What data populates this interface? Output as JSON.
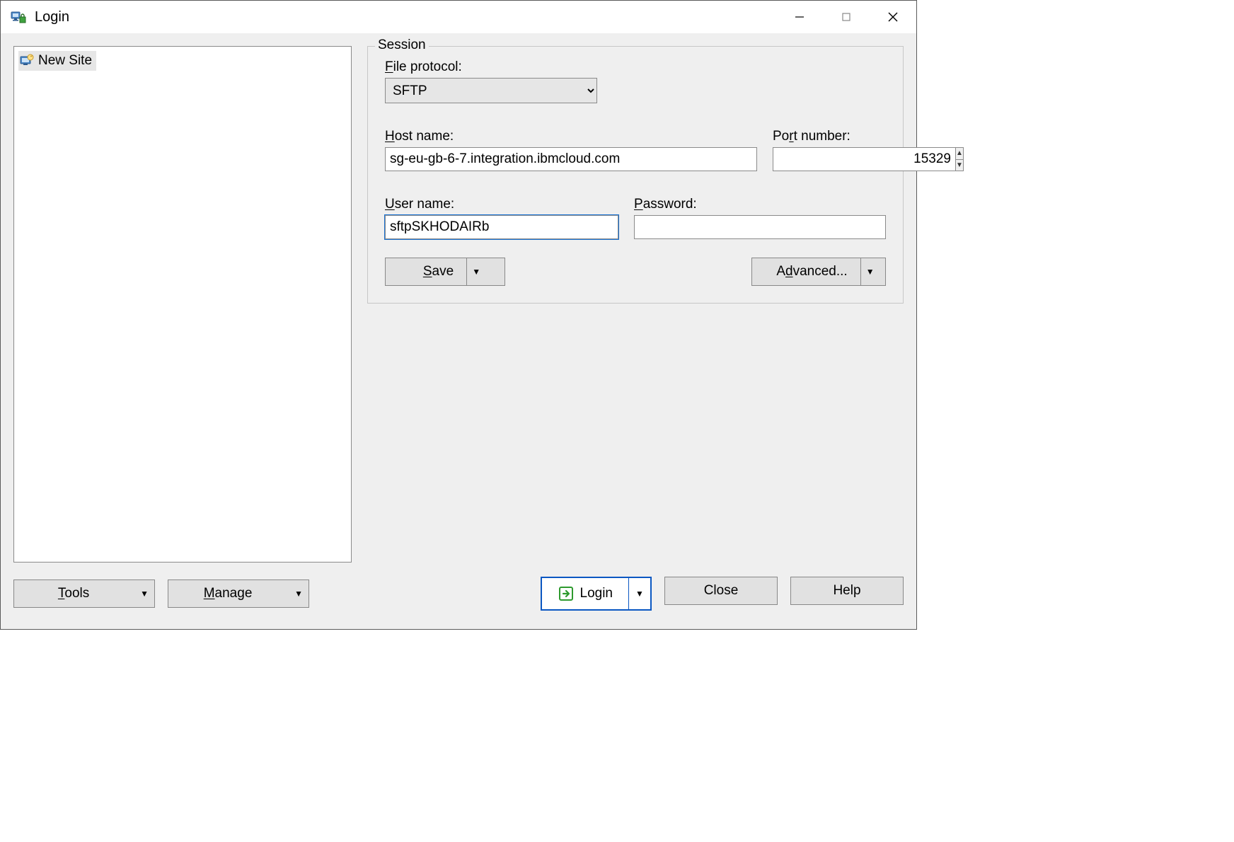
{
  "window": {
    "title": "Login"
  },
  "sites": {
    "new_site_label": "New Site"
  },
  "session": {
    "legend": "Session",
    "protocol_label": "File protocol:",
    "protocol_value": "SFTP",
    "host_label": "Host name:",
    "host_value": "sg-eu-gb-6-7.integration.ibmcloud.com",
    "port_label": "Port number:",
    "port_value": "15329",
    "user_label": "User name:",
    "user_value": "sftpSKHODAIRb",
    "password_label": "Password:",
    "password_value": "",
    "save_label": "Save",
    "advanced_label": "Advanced..."
  },
  "bottom": {
    "tools_label": "Tools",
    "manage_label": "Manage",
    "login_label": "Login",
    "close_label": "Close",
    "help_label": "Help"
  }
}
